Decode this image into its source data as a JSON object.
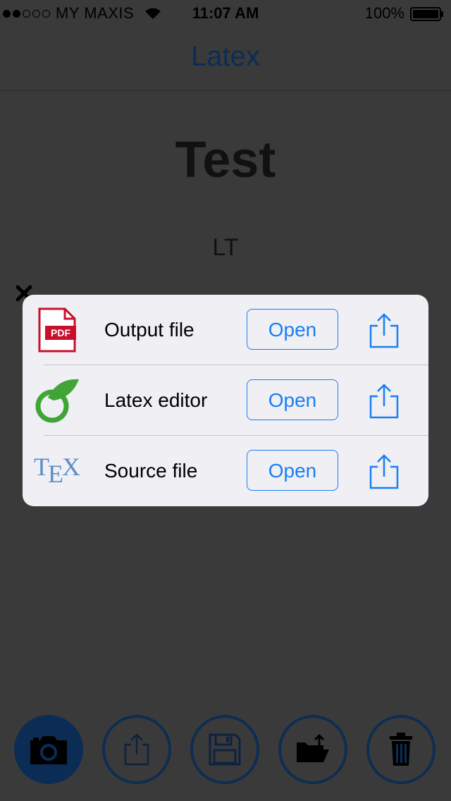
{
  "status_bar": {
    "carrier": "MY MAXIS",
    "time": "11:07 AM",
    "battery": "100%"
  },
  "nav": {
    "title": "Latex"
  },
  "document": {
    "title": "Test",
    "subtitle": "LT"
  },
  "popup": {
    "rows": [
      {
        "label": "Output file",
        "open_label": "Open",
        "icon": "pdf-icon"
      },
      {
        "label": "Latex editor",
        "open_label": "Open",
        "icon": "overleaf-icon"
      },
      {
        "label": "Source file",
        "open_label": "Open",
        "icon": "tex-icon"
      }
    ]
  },
  "toolbar": {
    "items": [
      "camera-icon",
      "share-icon",
      "floppy-disk-icon",
      "folder-upload-icon",
      "trash-icon"
    ]
  },
  "colors": {
    "background": "#3a3a3a",
    "accent": "#1a7ef5",
    "toolbar_blue": "#0b2d55",
    "popup_bg": "#efeff4"
  }
}
